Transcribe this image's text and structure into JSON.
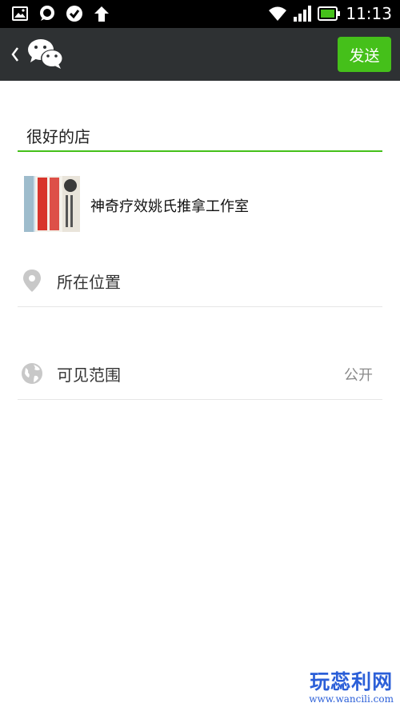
{
  "status_bar": {
    "time": "11:13",
    "left_icons": [
      "gallery-icon",
      "chat-bubble-icon",
      "check-circle-icon",
      "upload-arrow-icon"
    ],
    "right_icons": [
      "wifi-icon",
      "signal-icon",
      "battery-icon"
    ]
  },
  "header": {
    "back_icon": "back-chevron-icon",
    "logo": "wechat-logo",
    "send_label": "发送",
    "accent_color": "#45c01a"
  },
  "composer": {
    "text": "很好的店"
  },
  "shared_link": {
    "title": "神奇疗效姚氏推拿工作室"
  },
  "location_row": {
    "icon": "location-pin-icon",
    "label": "所在位置"
  },
  "visibility_row": {
    "icon": "globe-icon",
    "label": "可见范围",
    "value": "公开"
  },
  "watermark": {
    "text": "玩蕊利网",
    "url": "www.wancili.com"
  }
}
